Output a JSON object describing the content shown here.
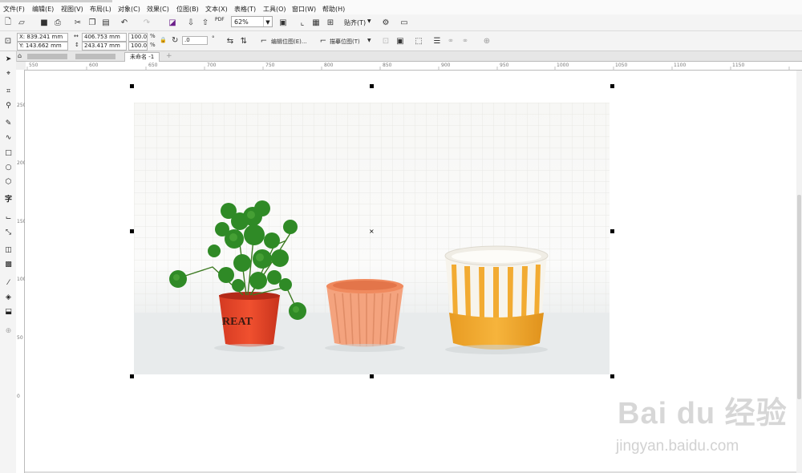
{
  "menu": [
    "文件(F)",
    "编辑(E)",
    "视图(V)",
    "布局(L)",
    "对象(C)",
    "效果(C)",
    "位图(B)",
    "文本(X)",
    "表格(T)",
    "工具(O)",
    "窗口(W)",
    "帮助(H)"
  ],
  "toolbar": {
    "pdf_label": "PDF",
    "zoom_value": "62%",
    "snap_label": "贴齐(T)"
  },
  "properties": {
    "x_value": "X: 839.241 mm",
    "y_value": "Y: 143.662 mm",
    "width_value": "406.753 mm",
    "height_value": "243.417 mm",
    "scale_x": "100.0",
    "scale_y": "100.0",
    "percent": "%",
    "rotation_value": ".0",
    "degree_symbol": "°",
    "edit_bitmap_label": "编辑位图(E)...",
    "trace_bitmap_label": "描摹位图(T)"
  },
  "document_tab": "未命名 -1",
  "ruler": {
    "h_labels": [
      "550",
      "600",
      "650",
      "700",
      "750",
      "800",
      "850",
      "900",
      "950",
      "1000",
      "1050",
      "1100",
      "1150"
    ],
    "v_labels": [
      "250",
      "200",
      "150",
      "100",
      "50",
      "0"
    ]
  },
  "photo": {
    "pot_text": "REAT",
    "colors": {
      "red_pot": "#e5452a",
      "peach_pot": "#f4a37e",
      "yellow_pot": "#f2ab32",
      "leaf": "#2f8a26"
    }
  },
  "watermark": {
    "logo": "Bai du 经验",
    "url": "jingyan.baidu.com"
  }
}
